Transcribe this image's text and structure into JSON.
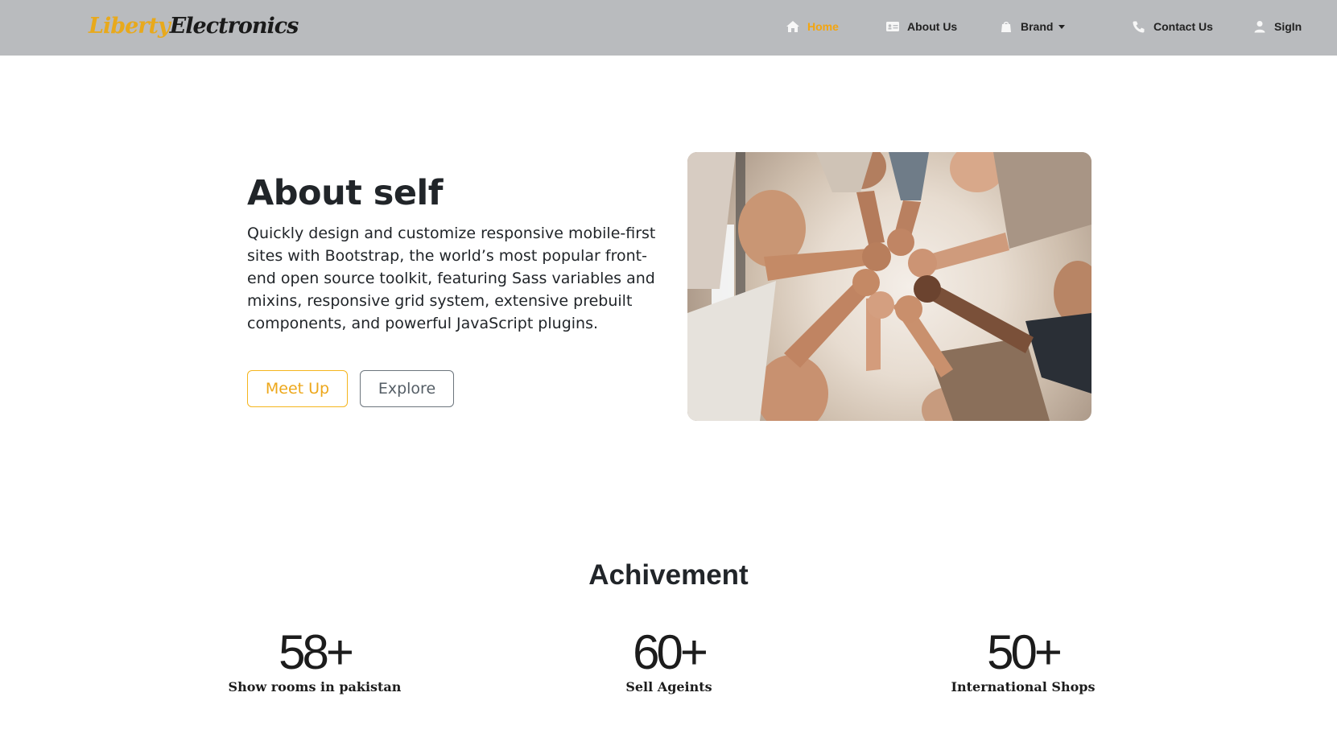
{
  "brand": {
    "part1": "Liberty",
    "part2": "Electronics"
  },
  "nav": {
    "home": "Home",
    "about": "About Us",
    "brand": "Brand",
    "contact": "Contact Us",
    "signin": "SigIn"
  },
  "hero": {
    "title": "About self",
    "text": "Quickly design and customize responsive mobile-first sites with Bootstrap, the world’s most popular front-end open source toolkit, featuring Sass variables and mixins, responsive grid system, extensive prebuilt components, and powerful JavaScript plugins.",
    "meet_label": "Meet Up",
    "explore_label": "Explore"
  },
  "achievement": {
    "title": "Achivement",
    "stats": [
      {
        "value": "58+",
        "label": "Show rooms in pakistan"
      },
      {
        "value": "60+",
        "label": "Sell Ageints"
      },
      {
        "value": "50+",
        "label": "International Shops"
      }
    ]
  },
  "colors": {
    "accent": "#f3a50f",
    "navbar_bg": "#b9bbbe"
  },
  "icons": {
    "home": "home-icon",
    "about": "id-card-icon",
    "brand": "bag-icon",
    "contact": "phone-icon",
    "signin": "user-icon"
  }
}
